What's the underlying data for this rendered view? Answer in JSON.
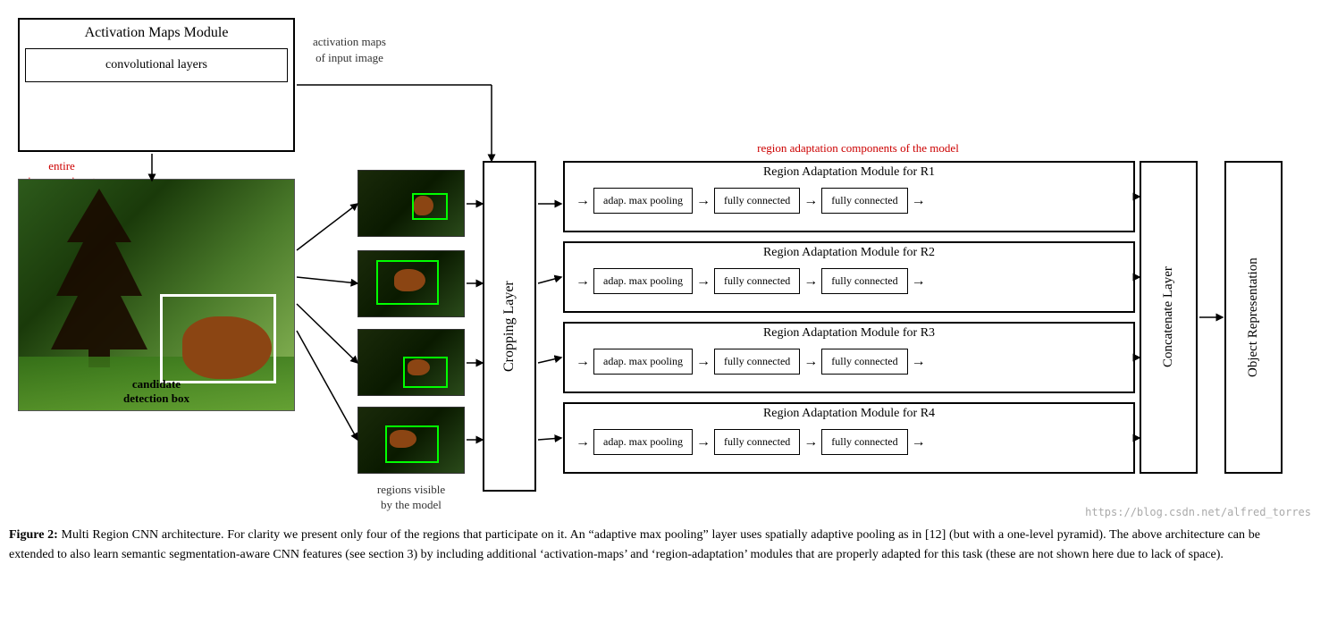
{
  "activation_module": {
    "title": "Activation Maps Module",
    "conv_layers": "convolutional layers"
  },
  "labels": {
    "entire_image": "entire\nimage as input",
    "activation_maps": "activation maps\nof input image",
    "regions_visible": "regions visible\nby the model",
    "candidate_detection": "candidate\ndetection box",
    "region_adapt_label": "region adaptation components of the model",
    "cropping_layer": "Cropping Layer",
    "concatenate_layer": "Concatenate Layer",
    "object_representation": "Object Representation"
  },
  "rams": [
    {
      "title": "Region Adaptation Module for R1",
      "pool": "adap. max pooling",
      "fc1": "fully connected",
      "fc2": "fully connected"
    },
    {
      "title": "Region Adaptation Module for R2",
      "pool": "adap. max pooling",
      "fc1": "fully connected",
      "fc2": "fully connected"
    },
    {
      "title": "Region Adaptation Module for R3",
      "pool": "adap. max pooling",
      "fc1": "fully connected",
      "fc2": "fully connected"
    },
    {
      "title": "Region Adaptation Module for R4",
      "pool": "adap. max pooling",
      "fc1": "fully connected",
      "fc2": "fully connected"
    }
  ],
  "caption": {
    "label": "Figure 2:",
    "text": " Multi Region CNN architecture. For clarity we present only four of the regions that participate on it. An “adaptive max pooling” layer uses spatially adaptive pooling as in [12] (but with a one-level pyramid). The above architecture can be extended to also learn semantic segmentation-aware CNN features (see section 3) by including additional ‘activation-maps’ and ‘region-adaptation’ modules that are properly adapted for this task (these are not shown here due to lack of space)."
  },
  "watermark": "https://blog.csdn.net/alfred_torres"
}
